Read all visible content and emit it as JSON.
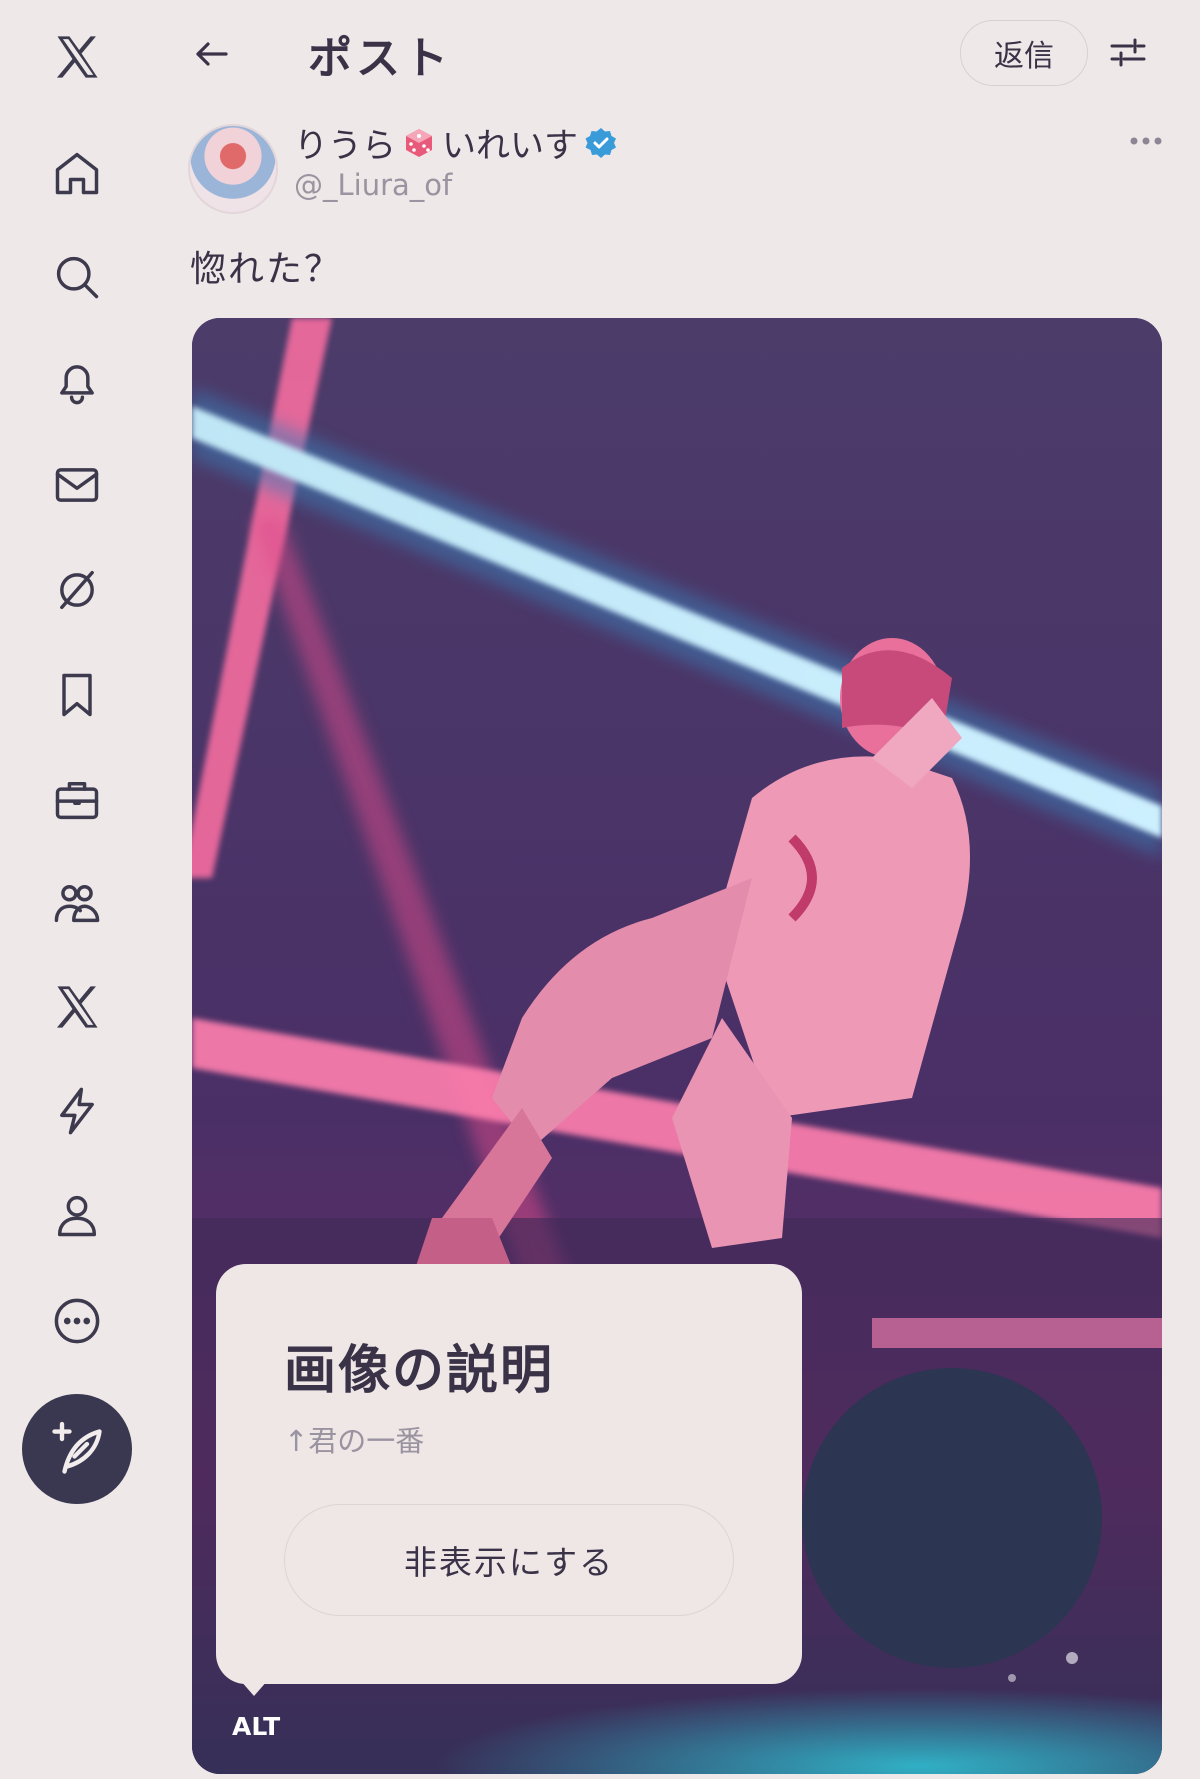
{
  "sidebar": {
    "icons": [
      "x-logo-icon",
      "home-icon",
      "search-icon",
      "notifications-icon",
      "messages-icon",
      "grok-icon",
      "bookmarks-icon",
      "jobs-icon",
      "communities-icon",
      "premium-x-icon",
      "verified-orgs-icon",
      "profile-icon",
      "more-icon"
    ],
    "compose_icon": "compose-post-icon"
  },
  "header": {
    "back_icon": "back-arrow-icon",
    "title": "ポスト",
    "reply_label": "返信",
    "filter_icon": "filter-sliders-icon"
  },
  "post": {
    "display_name_part1": "りうら",
    "display_name_part2": "いれいす",
    "handle": "@_Liura_of",
    "text": "惚れた？",
    "more_icon": "more-horizontal-icon"
  },
  "alt_popup": {
    "title": "画像の説明",
    "description": "↑君の一番",
    "hide_label": "非表示にする"
  },
  "alt_badge": "ALT",
  "colors": {
    "background": "#efe8e8",
    "text": "#3a3348",
    "secondary_text": "#9a94a0",
    "verified": "#3a9bd9",
    "compose_bg": "#3a3850"
  }
}
